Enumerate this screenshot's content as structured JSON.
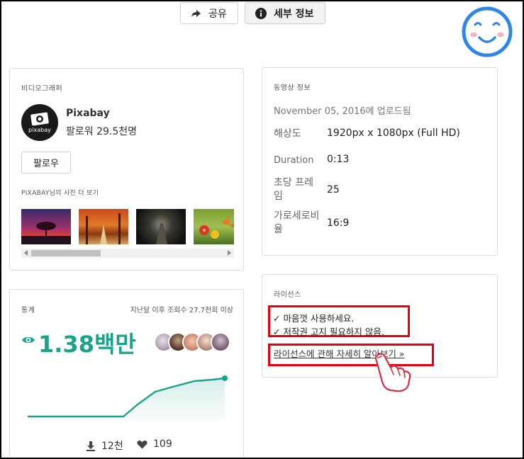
{
  "toolbar": {
    "share_label": "공유",
    "details_label": "세부 정보"
  },
  "video_card": {
    "heading": "비디오그래퍼",
    "uploader": "Pixabay",
    "avatar_text": "pixabay",
    "followers": "팔로워 29.5천명",
    "follow_label": "팔로우",
    "more_photos": "PIXABAY님의 사진 더 보기"
  },
  "info_card": {
    "heading": "동영상 정보",
    "uploaded": "November 05, 2016에 업로드됨",
    "rows": [
      {
        "label": "해상도",
        "value": "1920px x 1080px (Full HD)"
      },
      {
        "label": "Duration",
        "value": "0:13"
      },
      {
        "label": "초당 프레임",
        "value": "25"
      },
      {
        "label": "가로세로비율",
        "value": "16:9"
      }
    ]
  },
  "license_card": {
    "heading": "라이선스",
    "line1": "✓ 마음껏 사용하세요.",
    "line2": "✓ 저작권 고지 필요하지 않음.",
    "learn_more": "라이선스에 관해 자세히 알아보기 »"
  },
  "stats_card": {
    "heading": "통계",
    "subtitle": "지난달 이후 조회수 27.7천회 이상",
    "views": "1.38백만",
    "downloads": "12천",
    "likes": "109"
  },
  "colors": {
    "accent": "#1aa38a",
    "highlight": "#e60012"
  }
}
